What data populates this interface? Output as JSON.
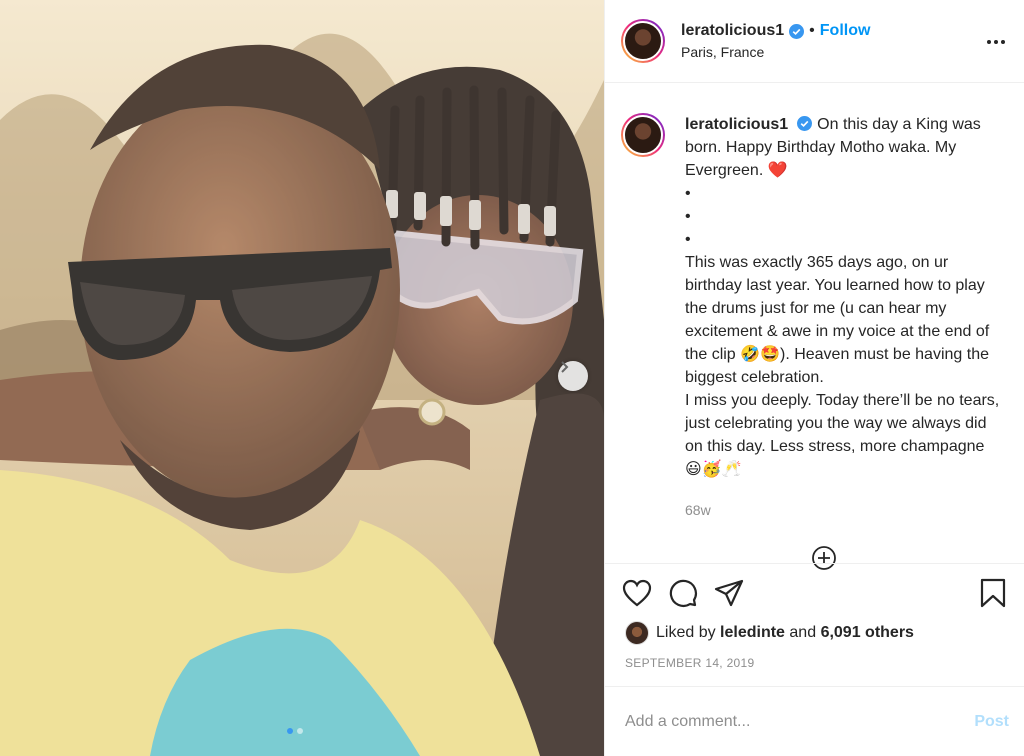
{
  "post": {
    "username": "leratolicious1",
    "follow_label": "Follow",
    "separator": "•",
    "location": "Paris, France",
    "caption_lines": [
      "On this day a King was born. Happy Birthday Motho waka. My Evergreen. ❤️",
      "•",
      "•",
      "•",
      "This was exactly 365 days ago, on ur birthday last year. You learned how to play the drums just for me (u can hear my excitement & awe in my voice at the end of the clip 🤣🤩). Heaven must be having the biggest celebration.",
      "I miss you deeply. Today there’ll be no tears, just celebrating you the way we always did on this day. Less stress, more champagne 😃🥳🥂"
    ],
    "age": "68w",
    "liked_by_prefix": "Liked by",
    "liked_by_user": "leledinte",
    "liked_by_and": "and",
    "liked_by_others": "6,091 others",
    "date": "SEPTEMBER 14, 2019"
  },
  "comment_box": {
    "placeholder": "Add a comment...",
    "post_label": "Post"
  },
  "colors": {
    "accent": "#0095f6",
    "muted": "#8e8e8e",
    "text": "#262626"
  },
  "icons": [
    "verified-badge-icon",
    "more-options-icon",
    "chevron-right-icon",
    "heart-icon",
    "comment-icon",
    "share-icon",
    "bookmark-icon",
    "plus-circle-icon"
  ]
}
